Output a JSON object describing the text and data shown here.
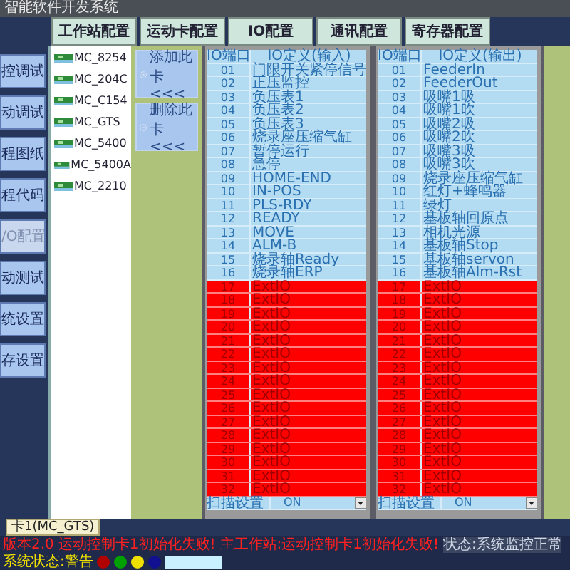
{
  "window": {
    "title": "智能软件开发系统"
  },
  "sidebar": {
    "items": [
      {
        "label": "控调试",
        "selected": false
      },
      {
        "label": "动调试",
        "selected": false
      },
      {
        "label": "程图纸",
        "selected": false
      },
      {
        "label": "程代码",
        "selected": false
      },
      {
        "label": "/O配置",
        "selected": true
      },
      {
        "label": "动测试",
        "selected": false
      },
      {
        "label": "统设置",
        "selected": false
      },
      {
        "label": "存设置",
        "selected": false
      }
    ]
  },
  "tabs": [
    {
      "label": "工作站配置"
    },
    {
      "label": "运动卡配置"
    },
    {
      "label": "IO配置"
    },
    {
      "label": "通讯配置"
    },
    {
      "label": "寄存器配置"
    }
  ],
  "cards": [
    {
      "name": "MC_8254"
    },
    {
      "name": "MC_204C"
    },
    {
      "name": "MC_C154"
    },
    {
      "name": "MC_GTS"
    },
    {
      "name": "MC_5400"
    },
    {
      "name": "MC_5400A"
    },
    {
      "name": "MC_2210"
    }
  ],
  "card_actions": [
    {
      "kind": "add",
      "label": "添加此卡 <<<"
    },
    {
      "kind": "remove",
      "label": "删除此卡 <<<"
    }
  ],
  "io_tables": [
    {
      "columns": [
        "IO端口",
        "IO定义(输入)"
      ],
      "rows": [
        {
          "port": "01",
          "name": "门限开关紧停信号",
          "reserved": false
        },
        {
          "port": "02",
          "name": "正压监控",
          "reserved": false
        },
        {
          "port": "03",
          "name": "负压表1",
          "reserved": false
        },
        {
          "port": "04",
          "name": "负压表2",
          "reserved": false
        },
        {
          "port": "05",
          "name": "负压表3",
          "reserved": false
        },
        {
          "port": "06",
          "name": "烧录座压缩气缸",
          "reserved": false
        },
        {
          "port": "07",
          "name": "暂停运行",
          "reserved": false
        },
        {
          "port": "08",
          "name": "急停",
          "reserved": false
        },
        {
          "port": "09",
          "name": "HOME-END",
          "reserved": false
        },
        {
          "port": "10",
          "name": "IN-POS",
          "reserved": false
        },
        {
          "port": "11",
          "name": "PLS-RDY",
          "reserved": false
        },
        {
          "port": "12",
          "name": "READY",
          "reserved": false
        },
        {
          "port": "13",
          "name": "MOVE",
          "reserved": false
        },
        {
          "port": "14",
          "name": "ALM-B",
          "reserved": false
        },
        {
          "port": "15",
          "name": "烧录轴Ready",
          "reserved": false
        },
        {
          "port": "16",
          "name": "烧录轴ERP",
          "reserved": false
        },
        {
          "port": "17",
          "name": "ExtIO",
          "reserved": true
        },
        {
          "port": "18",
          "name": "ExtIO",
          "reserved": true
        },
        {
          "port": "19",
          "name": "ExtIO",
          "reserved": true
        },
        {
          "port": "20",
          "name": "ExtIO",
          "reserved": true
        },
        {
          "port": "21",
          "name": "ExtIO",
          "reserved": true
        },
        {
          "port": "22",
          "name": "ExtIO",
          "reserved": true
        },
        {
          "port": "23",
          "name": "ExtIO",
          "reserved": true
        },
        {
          "port": "24",
          "name": "ExtIO",
          "reserved": true
        },
        {
          "port": "25",
          "name": "ExtIO",
          "reserved": true
        },
        {
          "port": "26",
          "name": "ExtIO",
          "reserved": true
        },
        {
          "port": "27",
          "name": "ExtIO",
          "reserved": true
        },
        {
          "port": "28",
          "name": "ExtIO",
          "reserved": true
        },
        {
          "port": "29",
          "name": "ExtIO",
          "reserved": true
        },
        {
          "port": "30",
          "name": "ExtIO",
          "reserved": true
        },
        {
          "port": "31",
          "name": "ExtIO",
          "reserved": true
        },
        {
          "port": "32",
          "name": "ExtIO",
          "reserved": true
        }
      ],
      "footer": {
        "label": "扫描设置",
        "value": "ON"
      }
    },
    {
      "columns": [
        "IO端口",
        "IO定义(输出)"
      ],
      "rows": [
        {
          "port": "01",
          "name": "FeederIn",
          "reserved": false
        },
        {
          "port": "02",
          "name": "FeederOut",
          "reserved": false
        },
        {
          "port": "03",
          "name": "吸嘴1吸",
          "reserved": false
        },
        {
          "port": "04",
          "name": "吸嘴1吹",
          "reserved": false
        },
        {
          "port": "05",
          "name": "吸嘴2吸",
          "reserved": false
        },
        {
          "port": "06",
          "name": "吸嘴2吹",
          "reserved": false
        },
        {
          "port": "07",
          "name": "吸嘴3吸",
          "reserved": false
        },
        {
          "port": "08",
          "name": "吸嘴3吹",
          "reserved": false
        },
        {
          "port": "09",
          "name": "烧录座压缩气缸",
          "reserved": false
        },
        {
          "port": "10",
          "name": "红灯+蜂鸣器",
          "reserved": false
        },
        {
          "port": "11",
          "name": "绿灯",
          "reserved": false
        },
        {
          "port": "12",
          "name": "基板轴回原点",
          "reserved": false
        },
        {
          "port": "13",
          "name": "相机光源",
          "reserved": false
        },
        {
          "port": "14",
          "name": "基板轴Stop",
          "reserved": false
        },
        {
          "port": "15",
          "name": "基板轴servon",
          "reserved": false
        },
        {
          "port": "16",
          "name": "基板轴Alm-Rst",
          "reserved": false
        },
        {
          "port": "17",
          "name": "ExtIO",
          "reserved": true
        },
        {
          "port": "18",
          "name": "ExtIO",
          "reserved": true
        },
        {
          "port": "19",
          "name": "ExtIO",
          "reserved": true
        },
        {
          "port": "20",
          "name": "ExtIO",
          "reserved": true
        },
        {
          "port": "21",
          "name": "ExtIO",
          "reserved": true
        },
        {
          "port": "22",
          "name": "ExtIO",
          "reserved": true
        },
        {
          "port": "23",
          "name": "ExtIO",
          "reserved": true
        },
        {
          "port": "24",
          "name": "ExtIO",
          "reserved": true
        },
        {
          "port": "25",
          "name": "ExtIO",
          "reserved": true
        },
        {
          "port": "26",
          "name": "ExtIO",
          "reserved": true
        },
        {
          "port": "27",
          "name": "ExtIO",
          "reserved": true
        },
        {
          "port": "28",
          "name": "ExtIO",
          "reserved": true
        },
        {
          "port": "29",
          "name": "ExtIO",
          "reserved": true
        },
        {
          "port": "30",
          "name": "ExtIO",
          "reserved": true
        },
        {
          "port": "31",
          "name": "ExtIO",
          "reserved": true
        },
        {
          "port": "32",
          "name": "ExtIO",
          "reserved": true
        }
      ],
      "footer": {
        "label": "扫描设置",
        "value": "ON"
      }
    }
  ],
  "bottom_tab": {
    "label": "卡1(MC_GTS)"
  },
  "status_bar": {
    "messages": [
      {
        "text": "版本2.0"
      },
      {
        "text": "运动控制卡1初始化失败!"
      },
      {
        "text": "主工作站:运动控制卡1初始化失败!"
      },
      {
        "text": "状态:系统监控正常"
      },
      {
        "text": "系统状态:警告"
      }
    ],
    "lights": [
      {
        "color": "#b00000"
      },
      {
        "color": "#00a000"
      },
      {
        "color": "#f0e000"
      },
      {
        "color": "#101090"
      }
    ]
  }
}
